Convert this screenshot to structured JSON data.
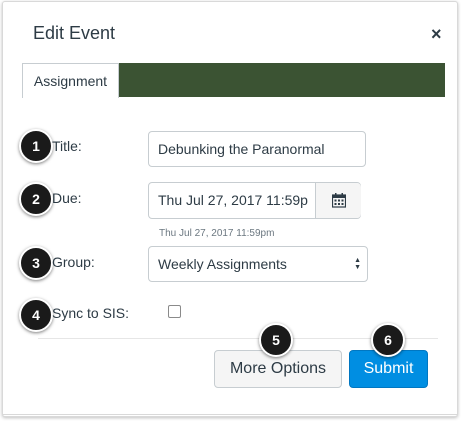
{
  "dialog": {
    "title": "Edit Event",
    "close_glyph": "×"
  },
  "tabs": [
    {
      "label": "Assignment",
      "active": true
    }
  ],
  "colors": {
    "tab_bar": "#3b5333",
    "submit": "#008ee2",
    "text": "#2d3b45"
  },
  "form": {
    "title": {
      "badge": "1",
      "label": "Title:",
      "value": "Debunking the Paranormal"
    },
    "due": {
      "badge": "2",
      "label": "Due:",
      "value": "Thu Jul 27, 2017 11:59p",
      "hint": "Thu Jul 27, 2017 11:59pm",
      "icon": "calendar-icon"
    },
    "group": {
      "badge": "3",
      "label": "Group:",
      "value": "Weekly Assignments"
    },
    "sync": {
      "badge": "4",
      "label": "Sync to SIS:",
      "checked": false
    }
  },
  "buttons": {
    "more_options": {
      "badge": "5",
      "label": "More Options"
    },
    "submit": {
      "badge": "6",
      "label": "Submit"
    }
  }
}
